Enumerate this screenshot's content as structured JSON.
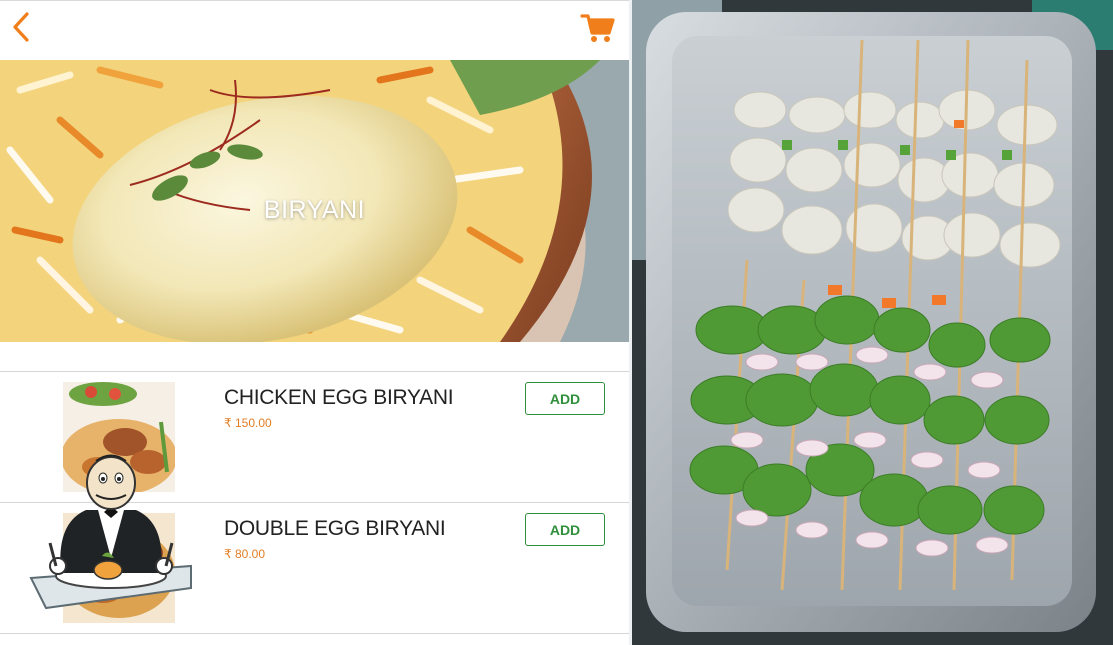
{
  "header": {
    "back_icon": "chevron-left-icon",
    "cart_icon": "cart-icon",
    "accent_color": "#f07f1b"
  },
  "hero": {
    "title": "BIRYANI"
  },
  "items": [
    {
      "name": "CHICKEN EGG BIRYANI",
      "price": "₹ 150.00",
      "add_label": "ADD"
    },
    {
      "name": "DOUBLE EGG BIRYANI",
      "price": "₹ 80.00",
      "add_label": "ADD"
    }
  ],
  "colors": {
    "price": "#e37d24",
    "add_button": "#2f8f3a"
  }
}
